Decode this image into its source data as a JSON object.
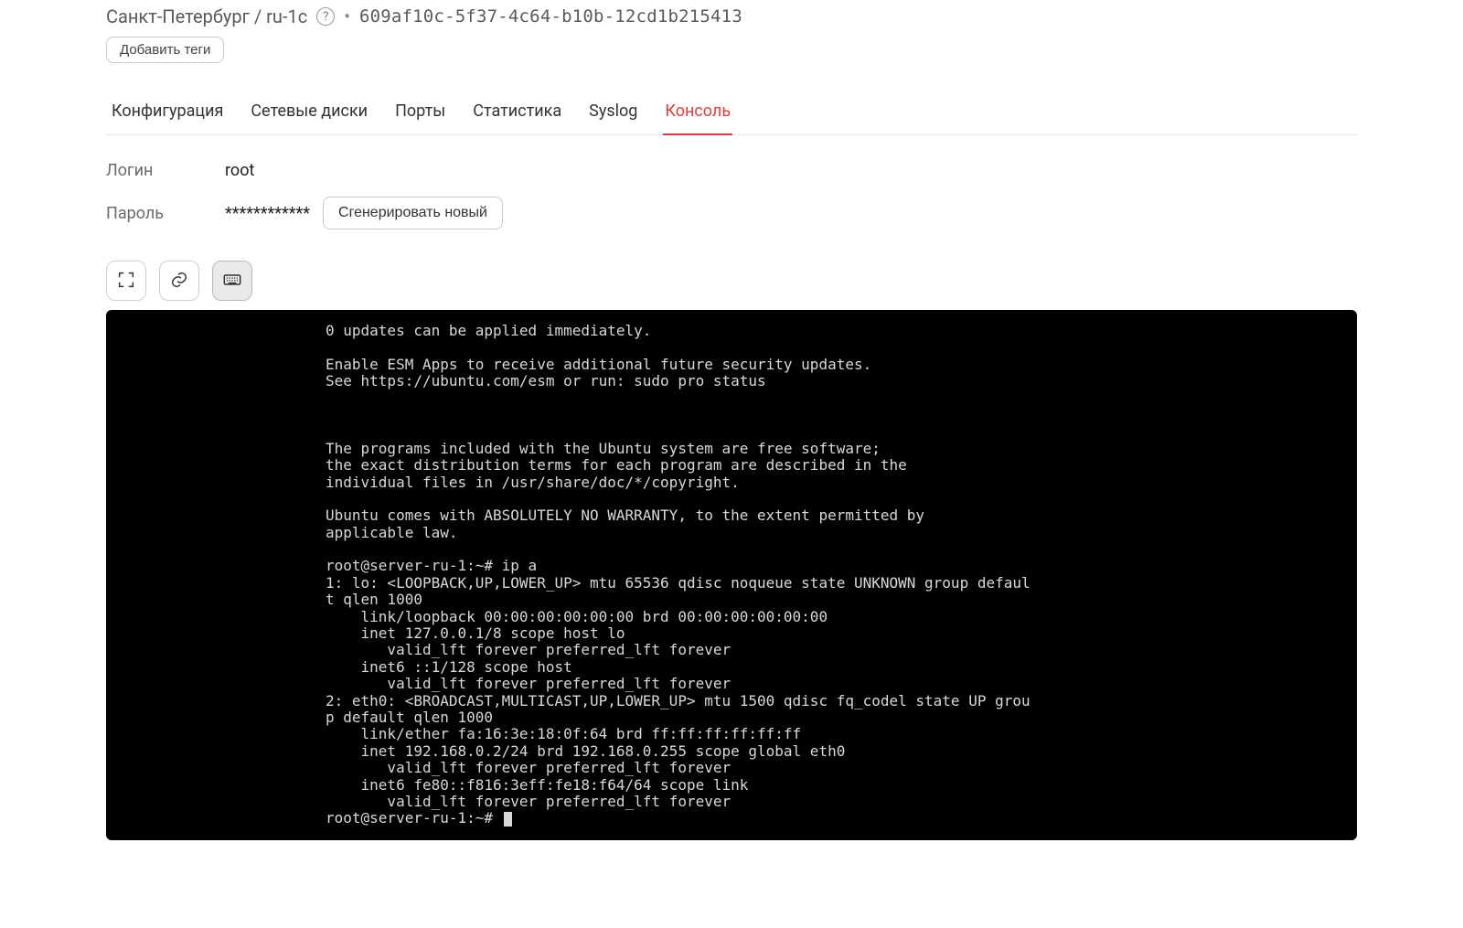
{
  "header": {
    "location": "Санкт-Петербург / ru-1c",
    "separator": "•",
    "uuid": "609af10c-5f37-4c64-b10b-12cd1b215413",
    "add_tags_label": "Добавить теги"
  },
  "tabs": [
    {
      "label": "Конфигурация",
      "active": false
    },
    {
      "label": "Сетевые диски",
      "active": false
    },
    {
      "label": "Порты",
      "active": false
    },
    {
      "label": "Статистика",
      "active": false
    },
    {
      "label": "Syslog",
      "active": false
    },
    {
      "label": "Консоль",
      "active": true
    }
  ],
  "creds": {
    "login_label": "Логин",
    "login_value": "root",
    "password_label": "Пароль",
    "password_value": "************",
    "generate_label": "Сгенерировать новый"
  },
  "toolbar": {
    "fullscreen": "fullscreen-icon",
    "link": "link-icon",
    "keyboard": "keyboard-icon"
  },
  "console_lines": [
    "0 updates can be applied immediately.",
    "",
    "Enable ESM Apps to receive additional future security updates.",
    "See https://ubuntu.com/esm or run: sudo pro status",
    "",
    "",
    "",
    "The programs included with the Ubuntu system are free software;",
    "the exact distribution terms for each program are described in the",
    "individual files in /usr/share/doc/*/copyright.",
    "",
    "Ubuntu comes with ABSOLUTELY NO WARRANTY, to the extent permitted by",
    "applicable law.",
    "",
    "root@server-ru-1:~# ip a",
    "1: lo: <LOOPBACK,UP,LOWER_UP> mtu 65536 qdisc noqueue state UNKNOWN group defaul",
    "t qlen 1000",
    "    link/loopback 00:00:00:00:00:00 brd 00:00:00:00:00:00",
    "    inet 127.0.0.1/8 scope host lo",
    "       valid_lft forever preferred_lft forever",
    "    inet6 ::1/128 scope host",
    "       valid_lft forever preferred_lft forever",
    "2: eth0: <BROADCAST,MULTICAST,UP,LOWER_UP> mtu 1500 qdisc fq_codel state UP grou",
    "p default qlen 1000",
    "    link/ether fa:16:3e:18:0f:64 brd ff:ff:ff:ff:ff:ff",
    "    inet 192.168.0.2/24 brd 192.168.0.255 scope global eth0",
    "       valid_lft forever preferred_lft forever",
    "    inet6 fe80::f816:3eff:fe18:f64/64 scope link",
    "       valid_lft forever preferred_lft forever",
    "root@server-ru-1:~# "
  ]
}
